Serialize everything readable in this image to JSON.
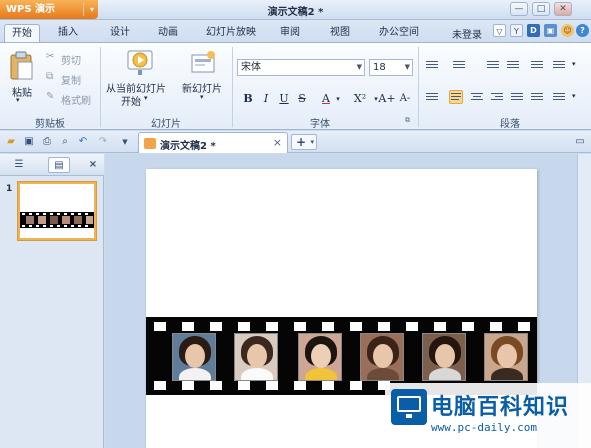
{
  "app": {
    "name": "WPS 演示",
    "menu_caret": "▾",
    "title": "演示文稿2 *"
  },
  "window_buttons": {
    "help": "?",
    "minimize": "—",
    "restore": "□",
    "close": "✕"
  },
  "tabs": [
    "开始",
    "插入",
    "设计",
    "动画",
    "幻灯片放映",
    "审阅",
    "视图",
    "办公空间"
  ],
  "active_tab": "开始",
  "user": {
    "login": "未登录"
  },
  "ribbon": {
    "clipboard": {
      "paste": "粘贴",
      "cut": "剪切",
      "copy": "复制",
      "format_painter": "格式刷",
      "label": "剪贴板"
    },
    "slides": {
      "from_current_line1": "从当前幻灯片",
      "from_current_line2": "开始",
      "new_slide": "新幻灯片",
      "label": "幻灯片"
    },
    "font": {
      "name": "宋体",
      "size": "18",
      "bold": "B",
      "italic": "I",
      "underline": "U",
      "strike": "S",
      "color": "A",
      "superscript": "X²",
      "grow": "A+",
      "shrink": "A-",
      "label": "字体"
    },
    "paragraph": {
      "label": "段落"
    }
  },
  "document_tab": {
    "name": "演示文稿2 *",
    "close": "×"
  },
  "new_tab": "+",
  "slide_panel": {
    "slide_number": "1"
  },
  "colors": {
    "accent": "#f0b252",
    "ribbon_border": "#9db4d3",
    "app_button": "#e5781a",
    "watermark_blue": "#0a5ea8"
  },
  "watermark": {
    "title": "电脑百科知识",
    "url": "www.pc-daily.com"
  }
}
